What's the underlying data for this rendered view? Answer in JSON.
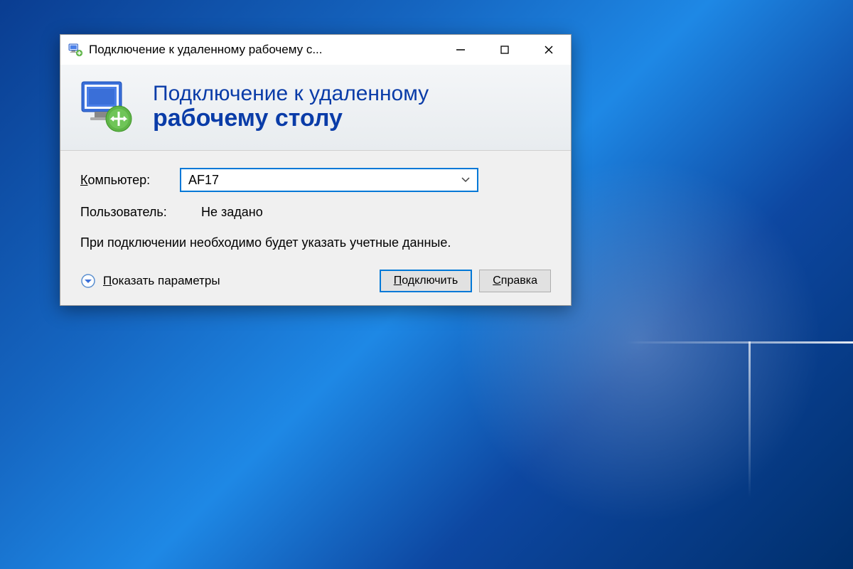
{
  "window": {
    "title": "Подключение к удаленному рабочему с..."
  },
  "header": {
    "line1": "Подключение к удаленному",
    "line2": "рабочему столу"
  },
  "form": {
    "computer_label_first": "К",
    "computer_label_rest": "омпьютер:",
    "computer_value": "AF17",
    "user_label": "Пользователь:",
    "user_value": "Не задано",
    "info_text": "При подключении необходимо будет указать учетные данные."
  },
  "footer": {
    "show_options_first": "П",
    "show_options_rest": "оказать параметры",
    "connect_first": "П",
    "connect_rest": "одключить",
    "help_first": "С",
    "help_rest": "правка"
  }
}
